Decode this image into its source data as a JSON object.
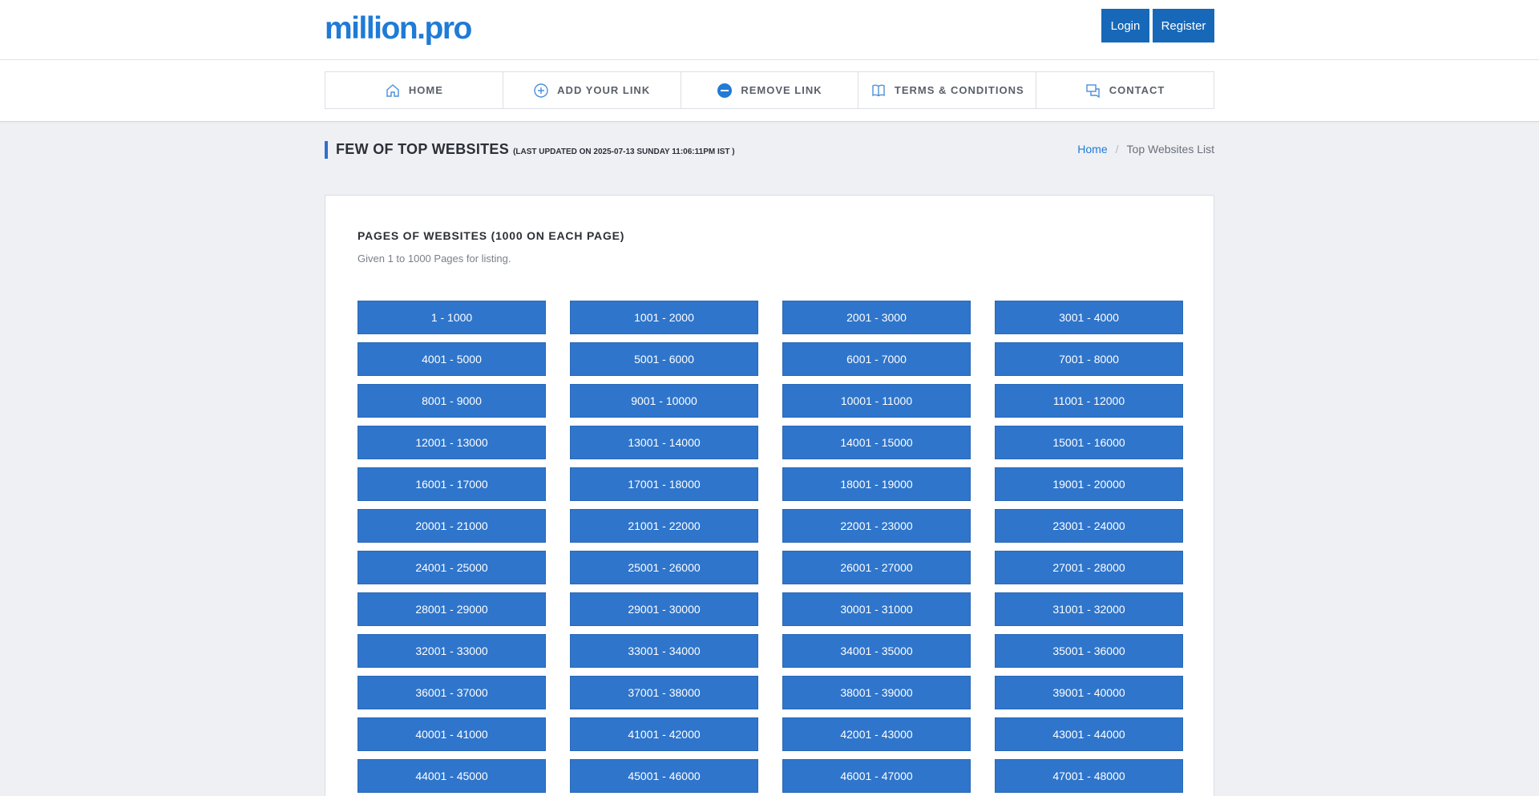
{
  "header": {
    "logo": "million.pro",
    "login_label": "Login",
    "register_label": "Register"
  },
  "nav": {
    "items": [
      {
        "label": "HOME",
        "icon": "home-icon"
      },
      {
        "label": "ADD YOUR LINK",
        "icon": "plus-circle-icon"
      },
      {
        "label": "REMOVE LINK",
        "icon": "minus-circle-icon"
      },
      {
        "label": "TERMS & CONDITIONS",
        "icon": "book-icon"
      },
      {
        "label": "CONTACT",
        "icon": "chat-icon"
      }
    ]
  },
  "page": {
    "title": "FEW OF TOP WEBSITES",
    "subtitle": "(LAST UPDATED ON 2025-07-13 SUNDAY 11:06:11PM IST )",
    "breadcrumb": {
      "home": "Home",
      "separator": "/",
      "current": "Top Websites List"
    }
  },
  "card": {
    "title": "PAGES OF WEBSITES (1000 ON EACH PAGE)",
    "subtitle": "Given 1 to 1000 Pages for listing.",
    "ranges": [
      "1 - 1000",
      "1001 - 2000",
      "2001 - 3000",
      "3001 - 4000",
      "4001 - 5000",
      "5001 - 6000",
      "6001 - 7000",
      "7001 - 8000",
      "8001 - 9000",
      "9001 - 10000",
      "10001 - 11000",
      "11001 - 12000",
      "12001 - 13000",
      "13001 - 14000",
      "14001 - 15000",
      "15001 - 16000",
      "16001 - 17000",
      "17001 - 18000",
      "18001 - 19000",
      "19001 - 20000",
      "20001 - 21000",
      "21001 - 22000",
      "22001 - 23000",
      "23001 - 24000",
      "24001 - 25000",
      "25001 - 26000",
      "26001 - 27000",
      "27001 - 28000",
      "28001 - 29000",
      "29001 - 30000",
      "30001 - 31000",
      "31001 - 32000",
      "32001 - 33000",
      "33001 - 34000",
      "34001 - 35000",
      "35001 - 36000",
      "36001 - 37000",
      "37001 - 38000",
      "38001 - 39000",
      "39001 - 40000",
      "40001 - 41000",
      "41001 - 42000",
      "42001 - 43000",
      "43001 - 44000",
      "44001 - 45000",
      "45001 - 46000",
      "46001 - 47000",
      "47001 - 48000"
    ]
  },
  "colors": {
    "brand": "#1f7bd6",
    "button": "#2f75cb",
    "auth_button": "#1768b8",
    "accent_bar": "#2f6fd0",
    "background": "#eef0f4"
  }
}
